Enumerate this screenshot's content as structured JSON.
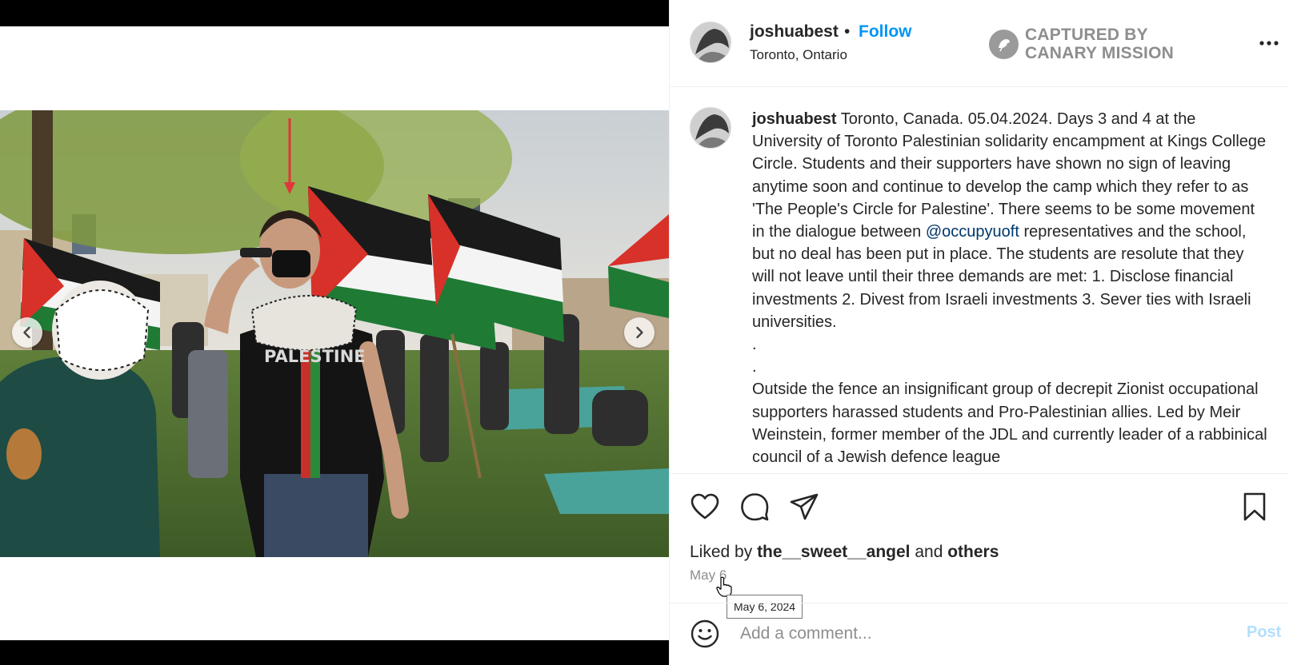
{
  "post": {
    "username": "joshuabest",
    "dot": "•",
    "follow_label": "Follow",
    "location": "Toronto, Ontario",
    "watermark_line1": "CAPTURED BY",
    "watermark_line2": "CANARY MISSION"
  },
  "caption": {
    "username": "joshuabest",
    "text_part1": "Toronto, Canada. 05.04.2024. Days 3 and 4 at the University of Toronto Palestinian solidarity encampment at Kings College Circle. Students and their supporters have shown no sign of leaving anytime soon and continue to develop the camp which they refer to as 'The People's Circle for Palestine'. There seems to be some movement in the dialogue between",
    "mention": "@occupyuoft",
    "text_part2": "representatives and the school, but no deal has been put in place. The students are resolute that they will not leave until their three demands are met: 1. Disclose financial investments 2. Divest from Israeli investments 3. Sever ties with Israeli universities.",
    "dot1": ".",
    "dot2": ".",
    "text_part3": "Outside the fence an insignificant group of decrepit Zionist occupational supporters harassed students and Pro-Palestinian allies. Led by Meir Weinstein, former member of the JDL and",
    "text_part4": "currently leader of a rabbinical council of a Jewish defence league"
  },
  "photo": {
    "shirt_text": "PALESTINE"
  },
  "engagement": {
    "liked_prefix": "Liked by",
    "liked_user": "the__sweet__angel",
    "liked_and": "and",
    "liked_others": "others",
    "date_short": "May 6",
    "date_tooltip": "May 6, 2024"
  },
  "comment": {
    "placeholder": "Add a comment...",
    "post_label": "Post"
  },
  "icons": {
    "prev": "chevron-left-icon",
    "next": "chevron-right-icon",
    "like": "heart-icon",
    "comment": "comment-icon",
    "share": "paper-plane-icon",
    "save": "bookmark-icon",
    "emoji": "smiley-icon",
    "more": "more-horizontal-icon",
    "watermark": "canary-bird-icon"
  },
  "colors": {
    "link_blue": "#0095f6",
    "mention_blue": "#00376b",
    "post_disabled": "#b2dffc",
    "secondary_text": "#8e8e8e"
  }
}
